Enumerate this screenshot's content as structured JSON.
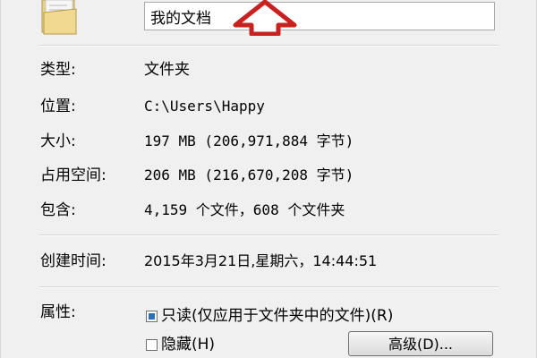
{
  "header": {
    "folder_name": "我的文档"
  },
  "properties": {
    "type_label": "类型:",
    "type_value": "文件夹",
    "location_label": "位置:",
    "location_value": "C:\\Users\\Happy",
    "size_label": "大小:",
    "size_value": "197 MB (206,971,884 字节)",
    "disk_size_label": "占用空间:",
    "disk_size_value": "206 MB (216,670,208 字节)",
    "contains_label": "包含:",
    "contains_value": "4,159 个文件，608 个文件夹",
    "created_label": "创建时间:",
    "created_value": "2015年3月21日,星期六，14:44:51"
  },
  "attributes": {
    "label": "属性:",
    "readonly_label": "只读(仅应用于文件夹中的文件)(R)",
    "hidden_label": "隐藏(H)",
    "advanced_button": "高级(D)..."
  },
  "colors": {
    "arrow": "#c8211f",
    "checkbox_fill": "#2a6fb8"
  }
}
